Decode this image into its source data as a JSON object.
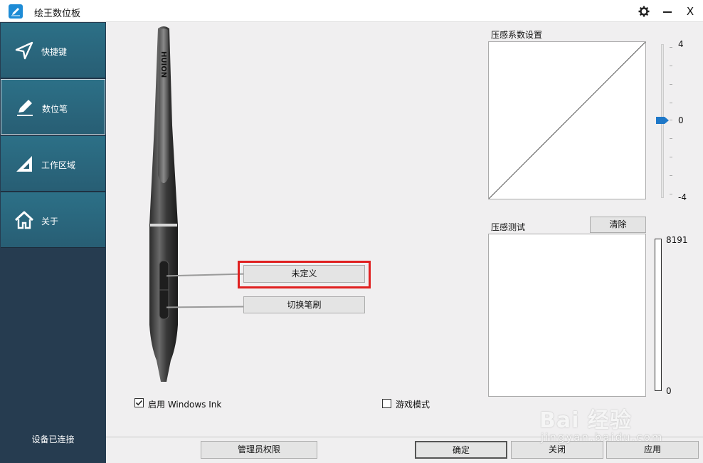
{
  "window": {
    "title": "绘王数位板",
    "settings_icon": "gear-icon",
    "minimize_icon": "minimize-icon",
    "close_icon": "close-icon",
    "close_glyph": "X"
  },
  "sidebar": {
    "items": [
      {
        "label": "快捷键",
        "icon": "send-arrow-icon",
        "active": false
      },
      {
        "label": "数位笔",
        "icon": "pen-icon",
        "active": true
      },
      {
        "label": "工作区域",
        "icon": "set-square-icon",
        "active": false
      },
      {
        "label": "关于",
        "icon": "home-icon",
        "active": false
      }
    ],
    "status": "设备已连接"
  },
  "pen": {
    "brand": "HUION",
    "upper_button_label": "未定义",
    "lower_button_label": "切换笔刷"
  },
  "options": {
    "windows_ink": {
      "label": "启用 Windows Ink",
      "checked": true
    },
    "game_mode": {
      "label": "游戏模式",
      "checked": false
    }
  },
  "pressure_curve": {
    "title": "压感系数设置",
    "slider_max": "4",
    "slider_mid": "0",
    "slider_min": "-4",
    "slider_value": 0
  },
  "pressure_test": {
    "title": "压感测试",
    "clear_label": "清除",
    "max_label": "8191",
    "min_label": "0"
  },
  "footer": {
    "admin_label": "管理员权限",
    "ok_label": "确定",
    "close_label": "关闭",
    "apply_label": "应用"
  },
  "watermark": {
    "logo": "Bai 经验",
    "url": "jingyan.baidu.com"
  },
  "colors": {
    "sidebar_bg": "#263c50",
    "nav_item_bg": "#2c7087",
    "accent_blue": "#1e78c8",
    "highlight_red": "#e02020"
  }
}
